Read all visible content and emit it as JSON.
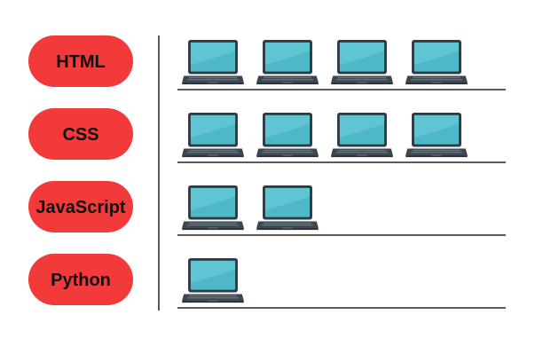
{
  "chart_data": {
    "type": "pictograph",
    "icon": "laptop-icon",
    "categories": [
      "HTML",
      "CSS",
      "JavaScript",
      "Python"
    ],
    "values": [
      4,
      4,
      2,
      1
    ],
    "colors": {
      "label_pill": "#f23a3a",
      "label_text": "#111111",
      "screen": "#4fb8c8",
      "screen_bezel": "#2e3a44",
      "keyboard": "#3b4650",
      "axis_line": "#222222"
    }
  }
}
